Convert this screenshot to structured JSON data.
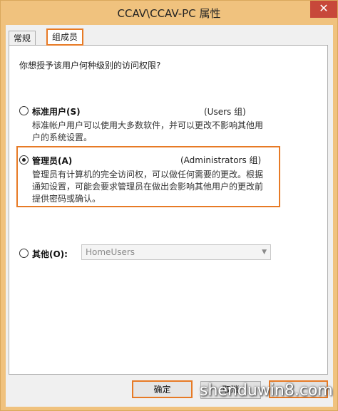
{
  "window": {
    "title": "CCAV\\CCAV-PC 属性",
    "close_glyph": "✕"
  },
  "tabs": [
    {
      "label": "常规"
    },
    {
      "label": "组成员"
    }
  ],
  "question": "你想授予该用户何种级别的访问权限?",
  "options": {
    "standard": {
      "label": "标准用户(S)",
      "group": "(Users 组)",
      "desc": "标准帐户用户可以使用大多数软件，并可以更改不影响其他用户的系统设置。"
    },
    "admin": {
      "label": "管理员(A)",
      "group": "(Administrators 组)",
      "desc": "管理员有计算机的完全访问权，可以做任何需要的更改。根据通知设置，可能会要求管理员在做出会影响其他用户的更改前提供密码或确认。"
    },
    "other": {
      "label": "其他(O):",
      "select_value": "HomeUsers",
      "arrow_glyph": "▼"
    }
  },
  "buttons": {
    "ok": "确定",
    "cancel": "取消",
    "apply": ""
  },
  "watermark": "shenduwin8.com",
  "colors": {
    "highlight": "#e77a25",
    "titlebar": "#f0c27e",
    "close": "#c7483a"
  }
}
